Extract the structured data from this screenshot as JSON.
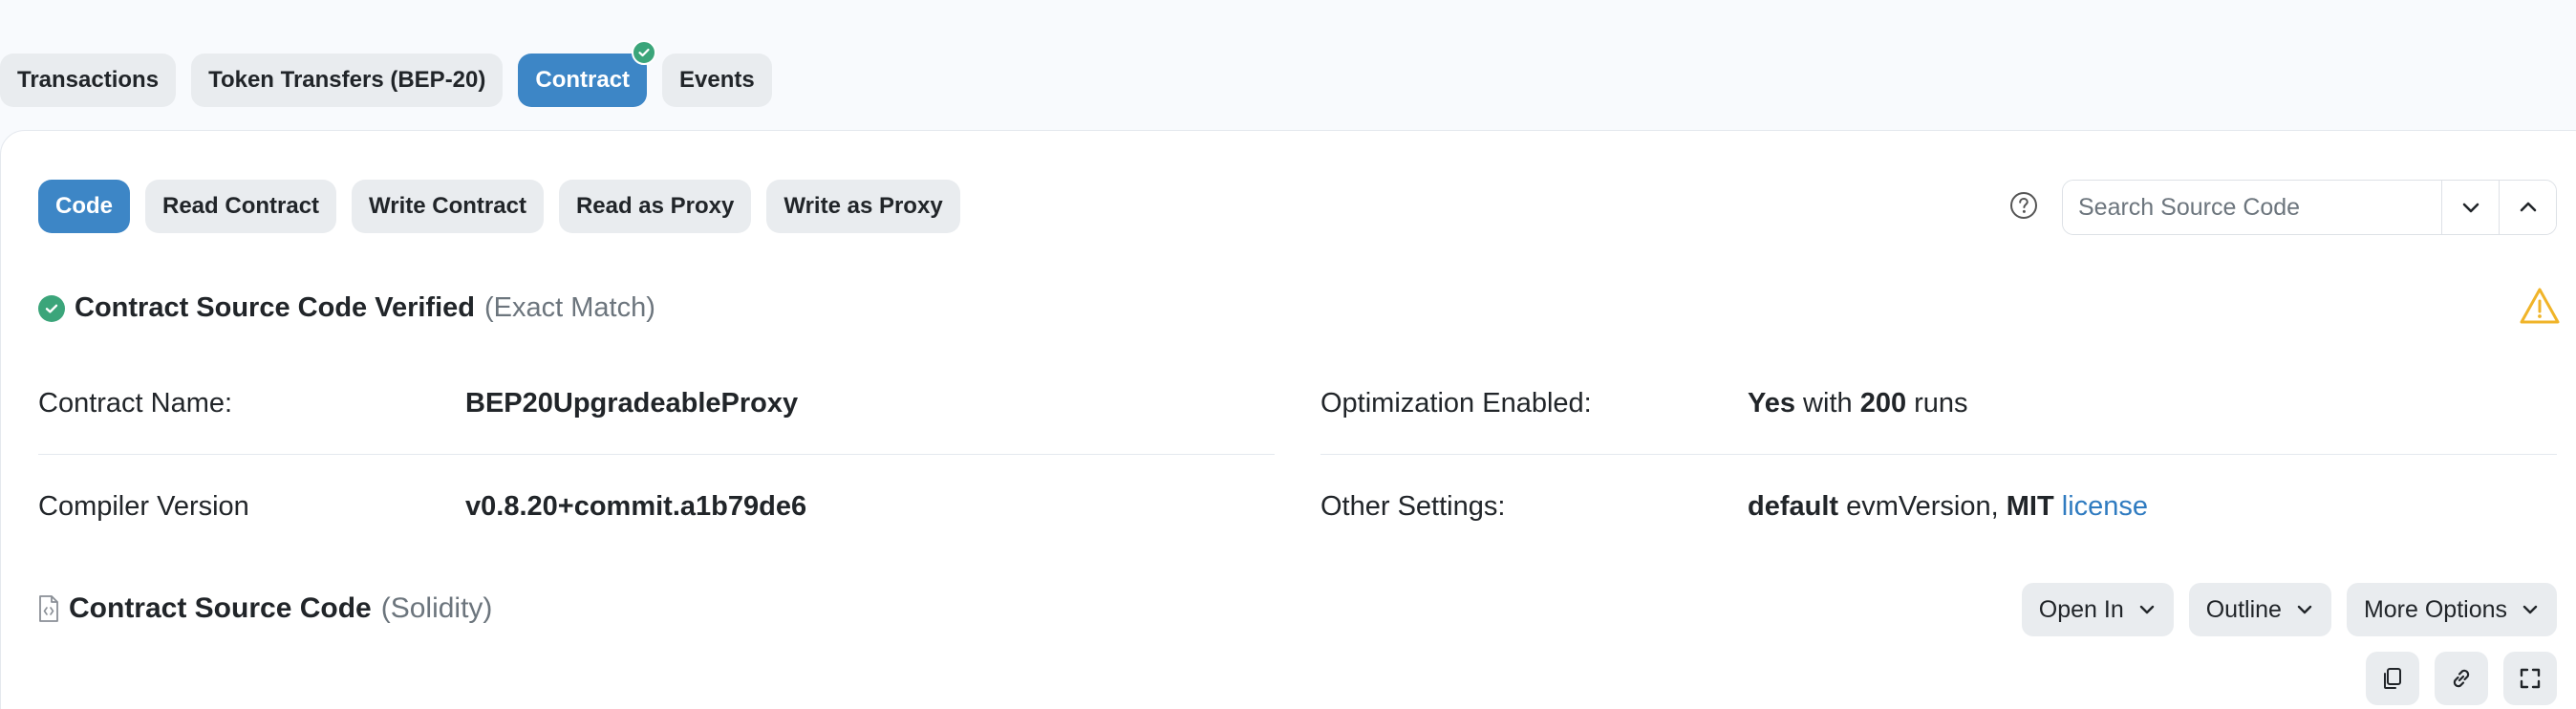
{
  "top_tabs": {
    "transactions": "Transactions",
    "token_transfers": "Token Transfers (BEP-20)",
    "contract": "Contract",
    "events": "Events"
  },
  "sub_tabs": {
    "code": "Code",
    "read_contract": "Read Contract",
    "write_contract": "Write Contract",
    "read_as_proxy": "Read as Proxy",
    "write_as_proxy": "Write as Proxy"
  },
  "search": {
    "placeholder": "Search Source Code"
  },
  "verified": {
    "title": "Contract Source Code Verified",
    "match": "(Exact Match)"
  },
  "details": {
    "contract_name_label": "Contract Name:",
    "contract_name_value": "BEP20UpgradeableProxy",
    "compiler_label": "Compiler Version",
    "compiler_value": "v0.8.20+commit.a1b79de6",
    "optimization_label": "Optimization Enabled:",
    "optimization_yes": "Yes",
    "optimization_with": " with ",
    "optimization_runs_count": "200",
    "optimization_runs": " runs",
    "other_settings_label": "Other Settings:",
    "other_default": "default",
    "other_evm": " evmVersion, ",
    "other_mit": "MIT",
    "other_license": "license"
  },
  "source": {
    "title": "Contract Source Code",
    "language": "(Solidity)"
  },
  "options": {
    "open_in": "Open In",
    "outline": "Outline",
    "more_options": "More Options"
  },
  "colors": {
    "accent": "#3d86c6",
    "success": "#3ba57a",
    "warning": "#f0b429",
    "link": "#2f7bc0"
  },
  "icons": {
    "verified": "check-circle-icon",
    "help": "question-circle-icon",
    "warning": "warning-triangle-icon",
    "file": "file-code-icon",
    "copy": "copy-icon",
    "link": "link-icon",
    "fullscreen": "fullscreen-icon"
  }
}
